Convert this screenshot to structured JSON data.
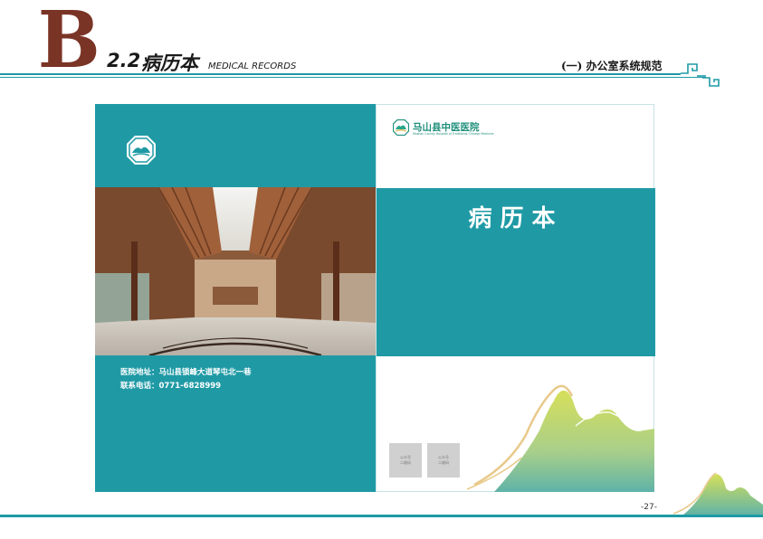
{
  "header": {
    "big_letter": "B",
    "section_number": "2.2",
    "section_title": "病历本",
    "section_en": "MEDICAL RECORDS",
    "right_label": "(一) 办公室系统规范"
  },
  "back_cover": {
    "address": "医院地址：马山县锁峰大道琴屯北一巷",
    "phone": "联系电话：0771-6828999"
  },
  "front_cover": {
    "hospital_name": "马山县中医医院",
    "hospital_name_en": "Mashan County Hospital of Traditional Chinese Medicine",
    "title": "病历本",
    "qr_labels": [
      "公众号\n二维码",
      "公众号\n二维码"
    ]
  },
  "footer": {
    "page_number": "-27-"
  },
  "colors": {
    "accent": "#1f9aa5",
    "brand_brown": "#7a3426",
    "logo_green": "#1f8f7c"
  },
  "icons": [
    "hospital-logo-icon",
    "mountain-decoration",
    "corner-pattern-icon"
  ]
}
